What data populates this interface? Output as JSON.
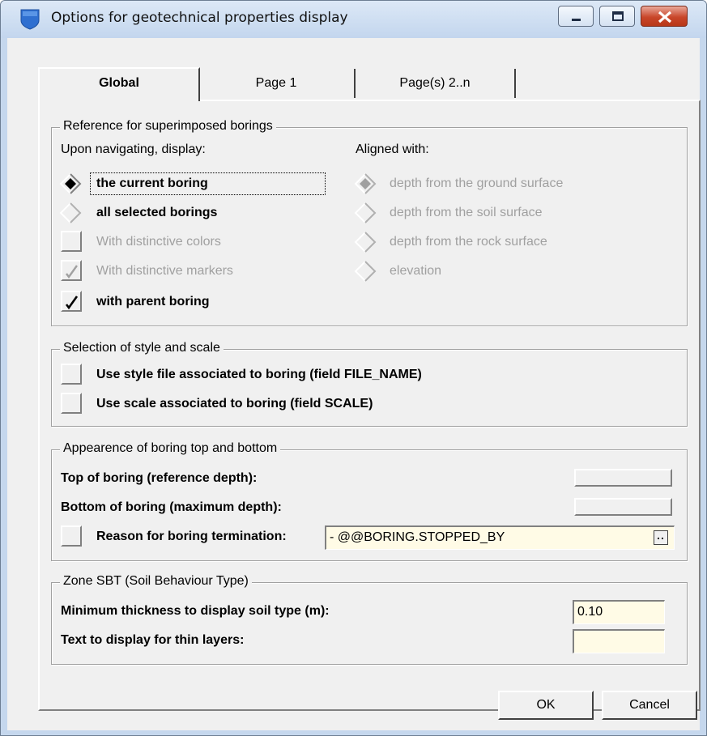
{
  "window": {
    "title": "Options for geotechnical properties display"
  },
  "tabs": [
    {
      "label": "Global",
      "active": true
    },
    {
      "label": "Page 1"
    },
    {
      "label": "Page(s) 2..n"
    }
  ],
  "reference": {
    "legend": "Reference for superimposed borings",
    "navigate_label": "Upon navigating, display:",
    "aligned_label": "Aligned with:",
    "display_options": [
      {
        "label": "the current boring",
        "selected": true,
        "enabled": true
      },
      {
        "label": "all selected borings",
        "selected": false,
        "enabled": true
      }
    ],
    "distinct_colors": {
      "label": "With distinctive colors",
      "checked": false,
      "enabled": false
    },
    "distinct_markers": {
      "label": "With distinctive markers",
      "checked": true,
      "enabled": false
    },
    "parent_boring": {
      "label": "with parent boring",
      "checked": true,
      "enabled": true
    },
    "aligned_options": [
      {
        "label": "depth from the ground surface",
        "selected": true,
        "enabled": false
      },
      {
        "label": "depth from the soil surface",
        "selected": false,
        "enabled": false
      },
      {
        "label": "depth from the rock surface",
        "selected": false,
        "enabled": false
      },
      {
        "label": "elevation",
        "selected": false,
        "enabled": false
      }
    ]
  },
  "style_scale": {
    "legend": "Selection of style and scale",
    "use_style": {
      "label": "Use style file associated to boring (field FILE_NAME)",
      "checked": false
    },
    "use_scale": {
      "label": "Use scale associated to boring (field SCALE)",
      "checked": false
    }
  },
  "appearance": {
    "legend": "Appearence of boring top and bottom",
    "top_label": "Top of boring (reference depth):",
    "bottom_label": "Bottom of boring (maximum depth):",
    "reason_label": "Reason for boring termination:",
    "reason_checked": false,
    "reason_value": "- @@BORING.STOPPED_BY"
  },
  "sbt": {
    "legend": "Zone SBT (Soil Behaviour Type)",
    "min_thickness_label": "Minimum thickness to display soil type (m):",
    "min_thickness_value": "0.10",
    "thin_text_label": "Text to display for thin layers:",
    "thin_text_value": ""
  },
  "buttons": {
    "ok": "OK",
    "cancel": "Cancel"
  },
  "colors": {
    "titlebar": "#c3d6ee",
    "close": "#c9462a",
    "input_bg": "#fffbe6",
    "disabled_text": "#a0a0a0"
  }
}
